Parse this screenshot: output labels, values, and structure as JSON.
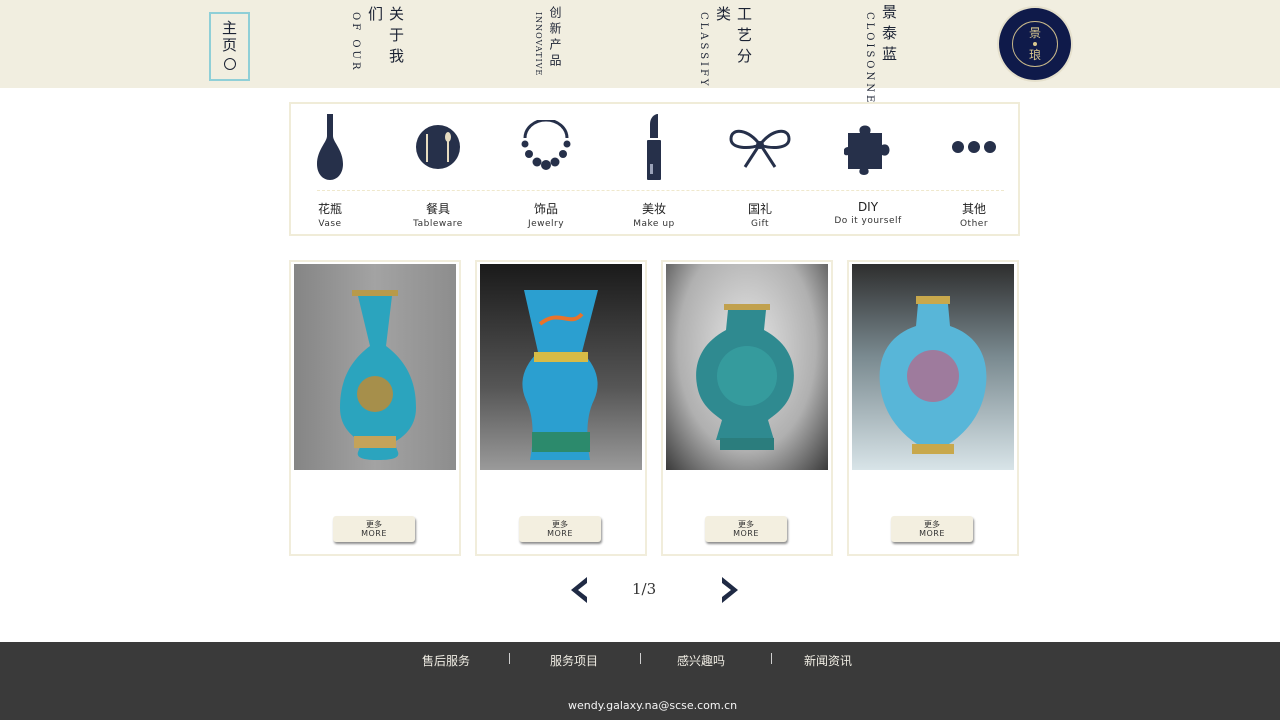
{
  "nav": {
    "home": {
      "label": "主页"
    },
    "items": [
      {
        "zh": "关于我们",
        "en": "OF OUR"
      },
      {
        "zh": "创新产品",
        "en": "INNOVATIVE"
      },
      {
        "zh": "工艺分类",
        "en": "CLASSIFY"
      },
      {
        "zh": "景泰蓝",
        "en": "CLOISONNE"
      }
    ],
    "logo": {
      "top": "景",
      "bottom": "琅"
    }
  },
  "categories": [
    {
      "zh": "花瓶",
      "en": "Vase",
      "icon": "vase-icon"
    },
    {
      "zh": "餐具",
      "en": "Tableware",
      "icon": "plate-cutlery-icon"
    },
    {
      "zh": "饰品",
      "en": "Jewelry",
      "icon": "necklace-icon"
    },
    {
      "zh": "美妆",
      "en": "Make up",
      "icon": "lipstick-icon"
    },
    {
      "zh": "国礼",
      "en": "Gift",
      "icon": "bow-icon"
    },
    {
      "zh": "DIY",
      "en": "Do it yourself",
      "icon": "puzzle-icon"
    },
    {
      "zh": "其他",
      "en": "Other",
      "icon": "more-dots-icon"
    }
  ],
  "products": [
    {
      "more_zh": "更多",
      "more_en": "MORE"
    },
    {
      "more_zh": "更多",
      "more_en": "MORE"
    },
    {
      "more_zh": "更多",
      "more_en": "MORE"
    },
    {
      "more_zh": "更多",
      "more_en": "MORE"
    }
  ],
  "pagination": {
    "text": "1/3"
  },
  "footer": {
    "links": [
      "售后服务",
      "服务项目",
      "感兴趣吗",
      "新闻资讯"
    ],
    "email": "wendy.galaxy.na@scse.com.cn"
  },
  "colors": {
    "accent": "#1f2a44",
    "nav_bg": "#f1eee0",
    "footer_bg": "#3a3a3a",
    "cloisonne": "#2e9fbf"
  }
}
